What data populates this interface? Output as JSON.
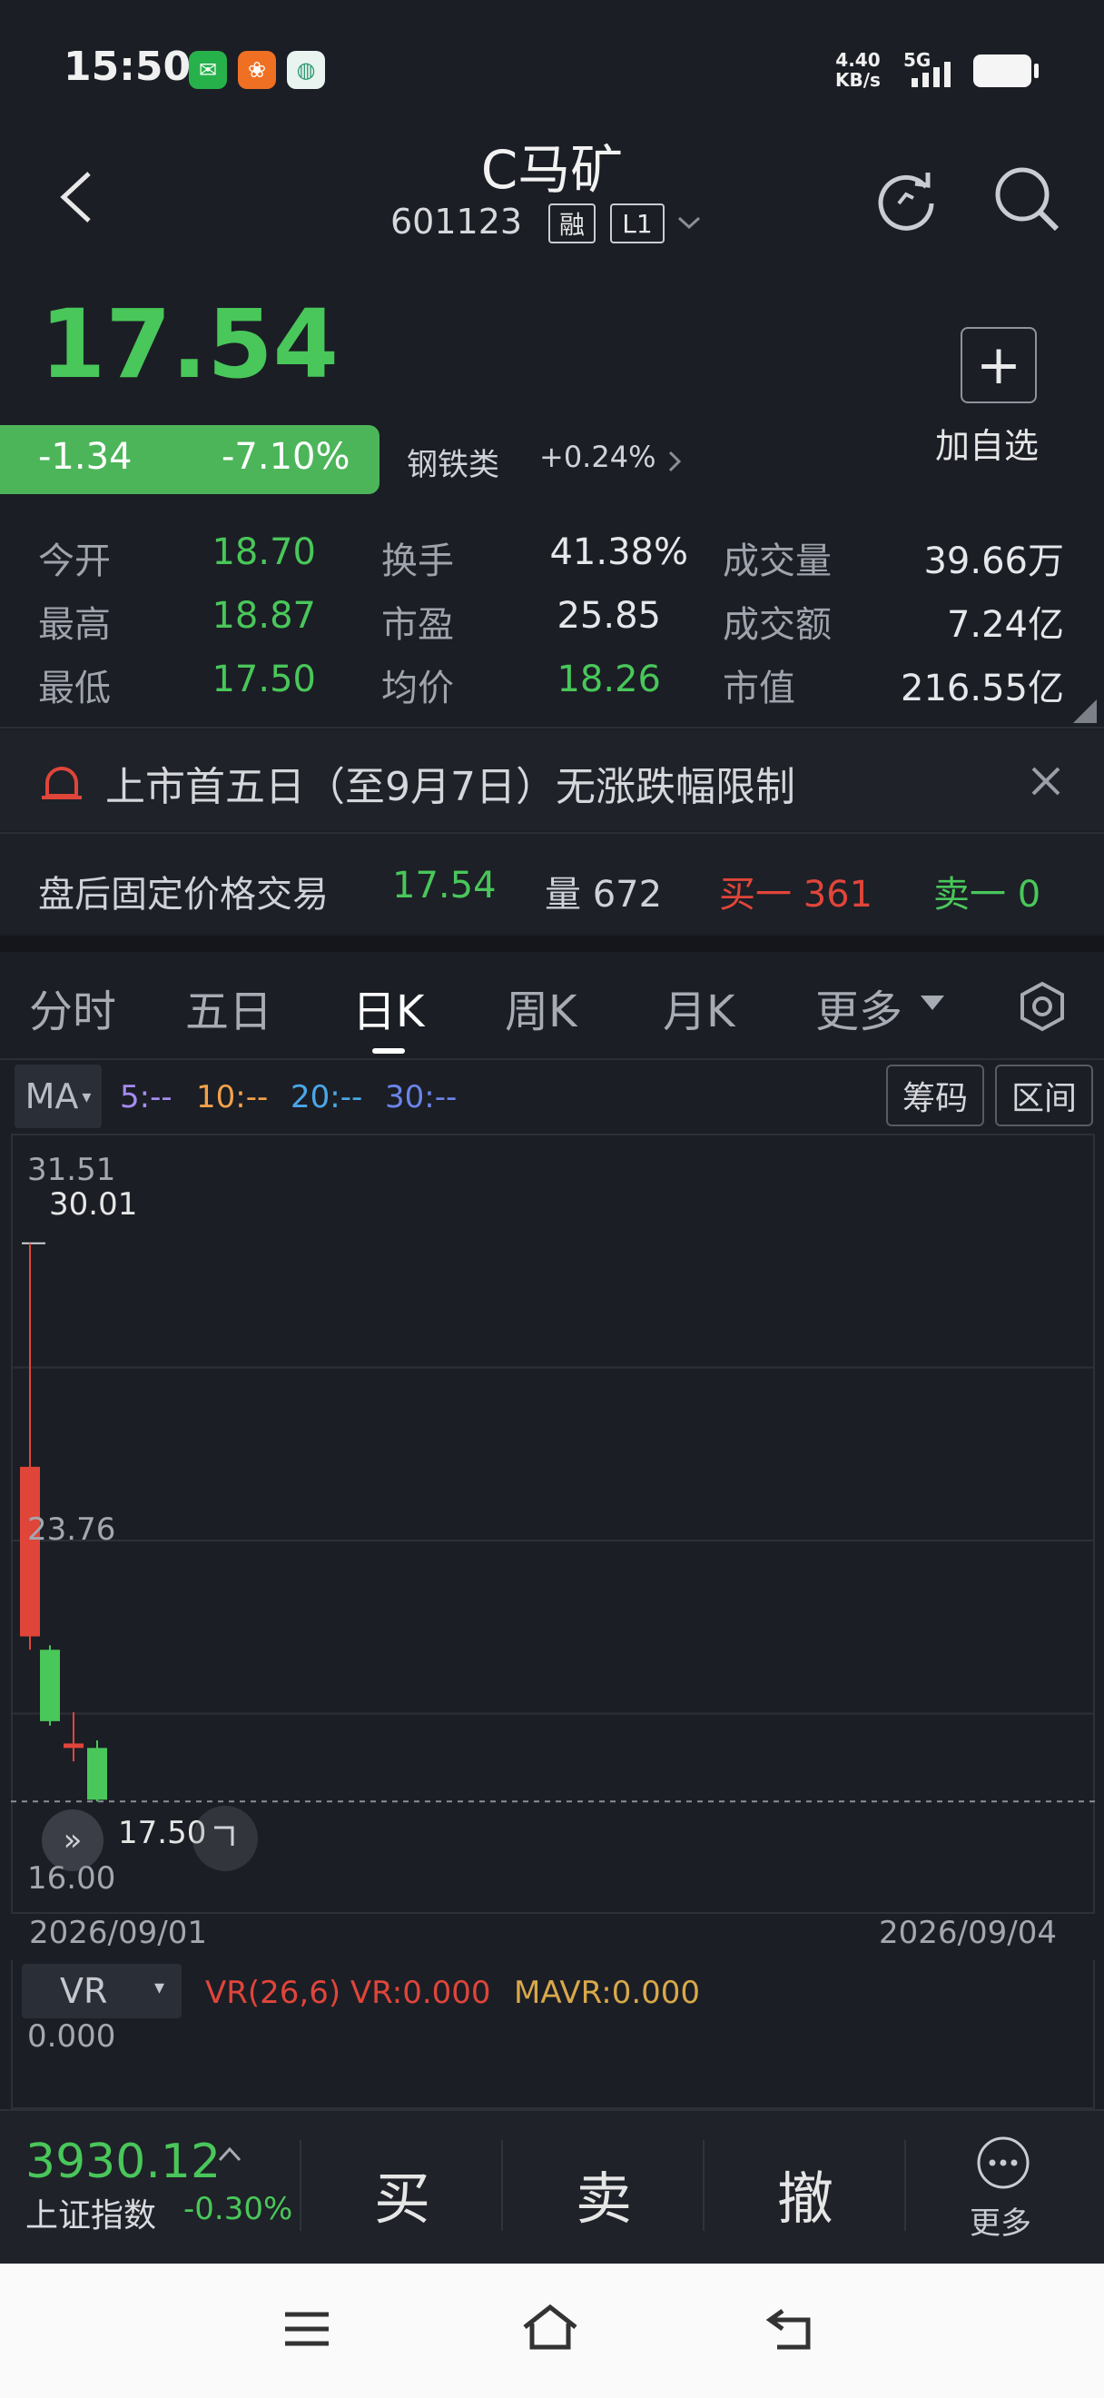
{
  "status": {
    "time": "15:50",
    "net_speed": "4.40",
    "net_unit": "KB/s",
    "network": "5G",
    "apps": [
      "wechat-icon",
      "app-orange-icon",
      "app-teal-icon"
    ]
  },
  "header": {
    "back_icon": "chevron-left-icon",
    "title": "C马矿",
    "code": "601123",
    "tag_margin": "融",
    "tag_level": "L1",
    "refresh_icon": "refresh-icon",
    "search_icon": "search-icon"
  },
  "quote": {
    "price": "17.54",
    "change": "-1.34",
    "change_pct": "-7.10%",
    "industry": "钢铁类",
    "industry_pct": "+0.24%",
    "add_label": "加自选",
    "rows": [
      [
        {
          "label": "今开",
          "value": "18.70",
          "color": "green"
        },
        {
          "label": "换手",
          "value": "41.38%",
          "color": "white"
        },
        {
          "label": "成交量",
          "value": "39.66万",
          "color": "white"
        }
      ],
      [
        {
          "label": "最高",
          "value": "18.87",
          "color": "green"
        },
        {
          "label": "市盈",
          "value": "25.85",
          "color": "white"
        },
        {
          "label": "成交额",
          "value": "7.24亿",
          "color": "white"
        }
      ],
      [
        {
          "label": "最低",
          "value": "17.50",
          "color": "green"
        },
        {
          "label": "均价",
          "value": "18.26",
          "color": "green"
        },
        {
          "label": "市值",
          "value": "216.55亿",
          "color": "white"
        }
      ]
    ]
  },
  "notice": {
    "text": "上市首五日（至9月7日）无涨跌幅限制"
  },
  "after_hours": {
    "label": "盘后固定价格交易",
    "price": "17.54",
    "volume_label": "量 672",
    "buy_label": "买一 361",
    "sell_label": "卖一 0"
  },
  "tabs": [
    "分时",
    "五日",
    "日K",
    "周K",
    "月K",
    "更多"
  ],
  "active_tab": "日K",
  "chart_controls": {
    "ma_label": "MA",
    "ma5": "5:--",
    "ma10": "10:--",
    "ma20": "20:--",
    "ma30": "30:--",
    "chips_label": "筹码",
    "range_label": "区间"
  },
  "chart_data": {
    "type": "candlestick",
    "ylim": [
      16.0,
      31.51
    ],
    "y_top_label": "31.51",
    "y_mid_label": "23.76",
    "y_bottom_label": "16.00",
    "high_marker": "30.01",
    "last_price_label": "17.50",
    "x_start_label": "2026/09/01",
    "x_end_label": "2026/09/04",
    "candles": [
      {
        "date": "2026/09/01",
        "open": 21.2,
        "close": 25.0,
        "high": 30.01,
        "low": 20.9
      },
      {
        "date": "2026/09/02",
        "open": 20.9,
        "close": 19.3,
        "high": 21.0,
        "low": 19.2
      },
      {
        "date": "2026/09/03",
        "open": 18.7,
        "close": 18.8,
        "high": 19.5,
        "low": 18.4
      },
      {
        "date": "2026/09/04",
        "open": 18.7,
        "close": 17.54,
        "high": 18.87,
        "low": 17.5
      }
    ],
    "grid": true
  },
  "indicator": {
    "select_label": "VR",
    "vr_title": "VR(26,6) VR:0.000",
    "mavr": "MAVR:0.000",
    "value_label": "0.000"
  },
  "bottom": {
    "index_value": "3930.12",
    "index_name": "上证指数",
    "index_pct": "-0.30%",
    "buy": "买",
    "sell": "卖",
    "cancel": "撤",
    "more": "更多"
  },
  "colors": {
    "up": "#e0453a",
    "down": "#49c75a",
    "bg": "#1b1e25"
  }
}
